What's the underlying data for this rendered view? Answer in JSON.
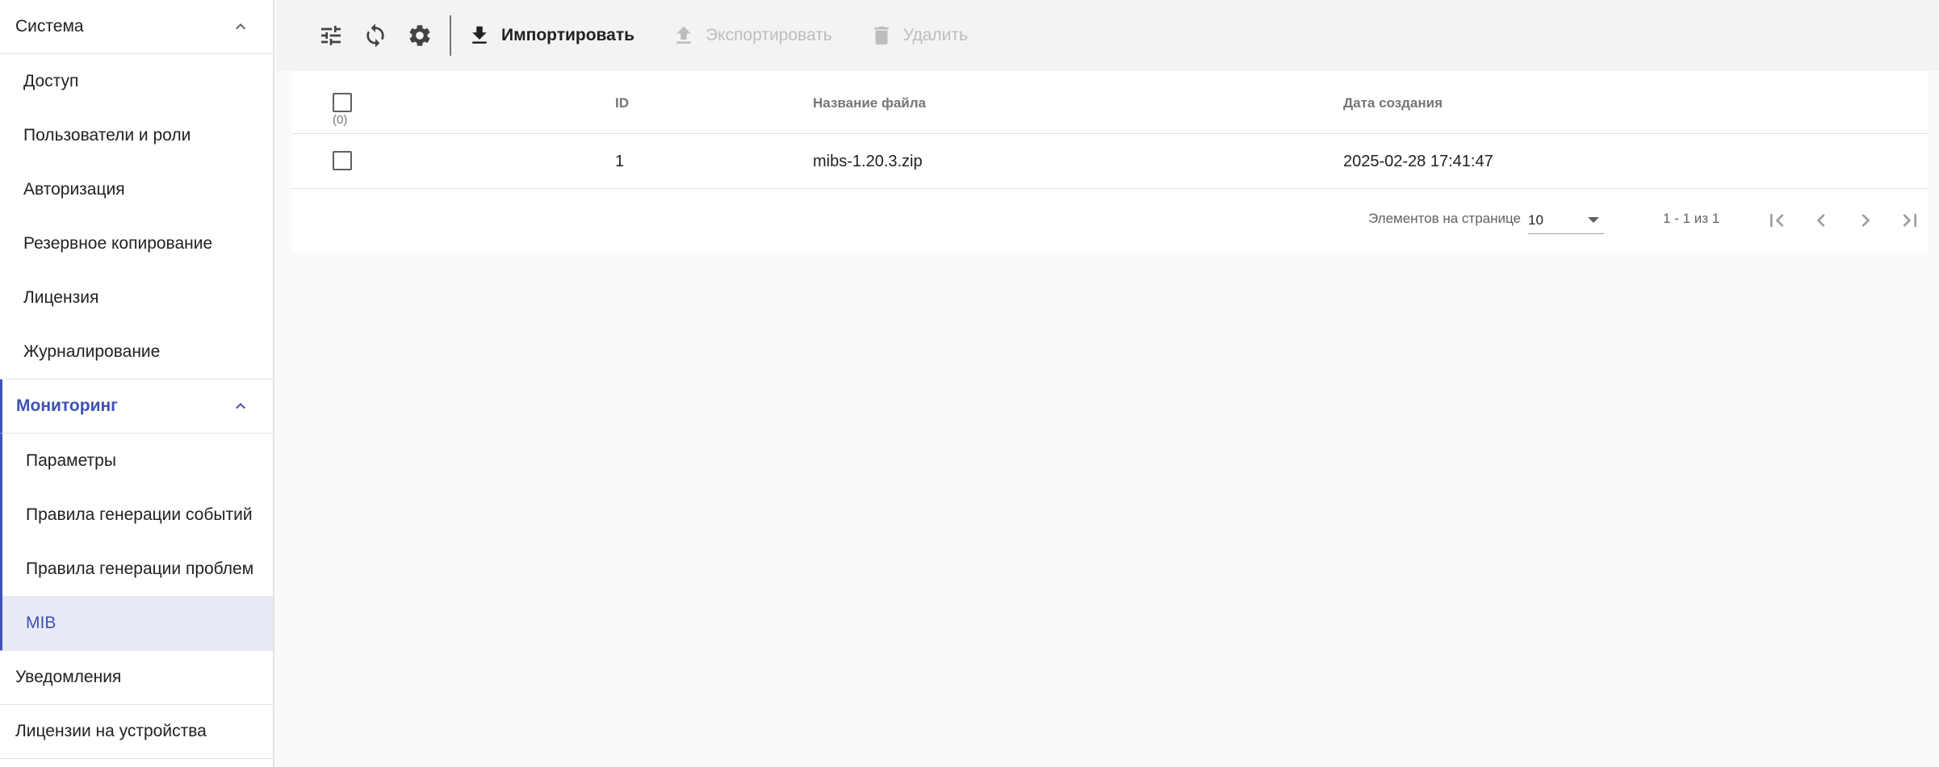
{
  "sidebar": {
    "system": {
      "label": "Система",
      "items": [
        "Доступ",
        "Пользователи и роли",
        "Авторизация",
        "Резервное копирование",
        "Лицензия",
        "Журналирование"
      ]
    },
    "monitoring": {
      "label": "Мониторинг",
      "items": [
        "Параметры",
        "Правила генерации событий",
        "Правила генерации проблем",
        "MIB"
      ],
      "selected": "MIB"
    },
    "notifications": "Уведомления",
    "device_licenses": "Лицензии на устройства"
  },
  "toolbar": {
    "icons": [
      "tune-icon",
      "sync-icon",
      "settings-icon"
    ],
    "import_label": "Импортировать",
    "export_label": "Экспортировать",
    "delete_label": "Удалить"
  },
  "table": {
    "selected_count": "(0)",
    "columns": {
      "id": "ID",
      "file_name": "Название файла",
      "created": "Дата создания"
    },
    "rows": [
      {
        "id": "1",
        "file_name": "mibs-1.20.3.zip",
        "created": "2025-02-28 17:41:47"
      }
    ]
  },
  "paginator": {
    "items_per_page_label": "Элементов на странице",
    "page_size": "10",
    "range_label": "1 - 1 из 1"
  },
  "colors": {
    "accent": "#3f51b5",
    "selected_bg": "#e8eaf6",
    "toolbar_bg": "#f3f3f3",
    "disabled": "#bdbdbd"
  }
}
